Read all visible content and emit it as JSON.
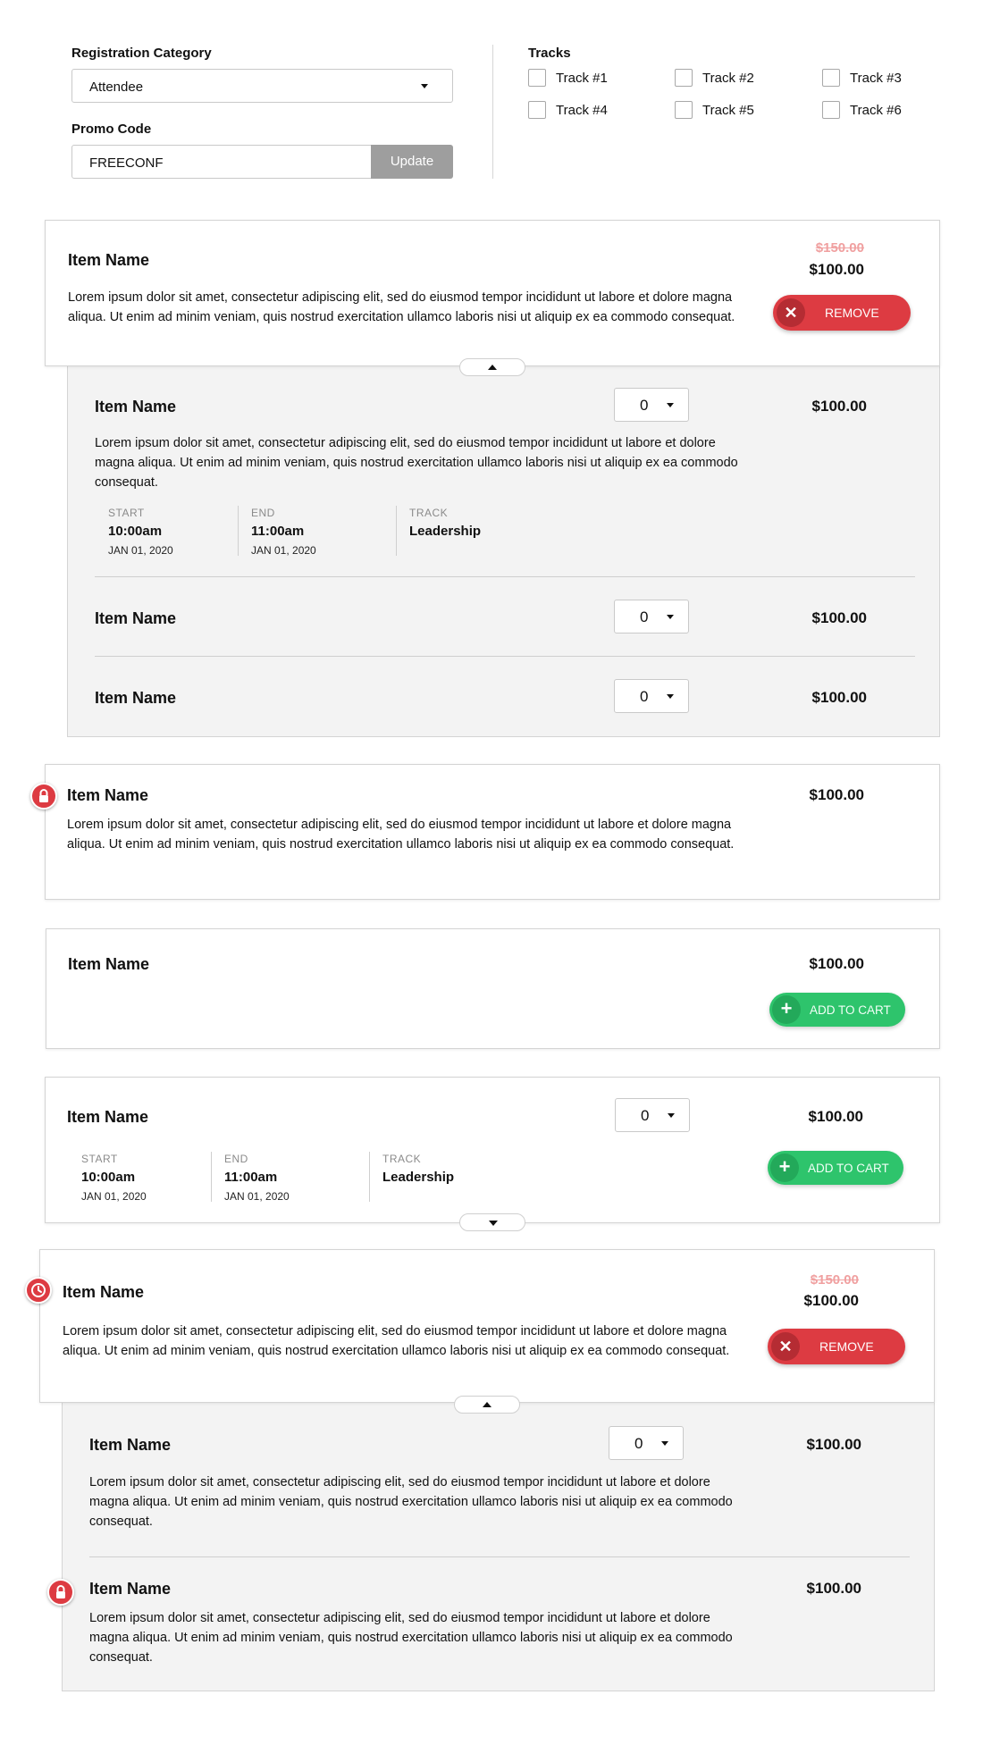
{
  "form": {
    "registration_category_label": "Registration Category",
    "registration_category_value": "Attendee",
    "promo_code_label": "Promo Code",
    "promo_code_value": "FREECONF",
    "update_label": "Update",
    "tracks_label": "Tracks",
    "tracks": [
      {
        "label": "Track #1",
        "checked": false
      },
      {
        "label": "Track #2",
        "checked": false
      },
      {
        "label": "Track #3",
        "checked": false
      },
      {
        "label": "Track #4",
        "checked": false
      },
      {
        "label": "Track #5",
        "checked": false
      },
      {
        "label": "Track #6",
        "checked": false
      }
    ]
  },
  "lorem": "Lorem ipsum dolor sit amet, consectetur adipiscing elit, sed do eiusmod tempor incididunt ut labore et dolore magna aliqua. Ut enim ad minim veniam, quis nostrud exercitation ullamco laboris nisi ut aliquip ex ea commodo consequat.",
  "item_name": "Item Name",
  "price": "$100.00",
  "old_price": "$150.00",
  "qty": "0",
  "remove_label": "REMOVE",
  "add_label": "ADD TO CART",
  "meta": {
    "start_label": "START",
    "end_label": "END",
    "track_label": "TRACK",
    "start_time": "10:00am",
    "end_time": "11:00am",
    "date": "JAN 01, 2020",
    "track": "Leadership"
  },
  "colors": {
    "remove": "#dd3b42",
    "add": "#2ec46c",
    "old_price": "#f0a0a0",
    "panel_bg": "#f3f3f3"
  },
  "icons": [
    "chevron-down-icon",
    "chevron-up-icon",
    "close-icon",
    "plus-icon",
    "lock-icon",
    "clock-icon"
  ]
}
